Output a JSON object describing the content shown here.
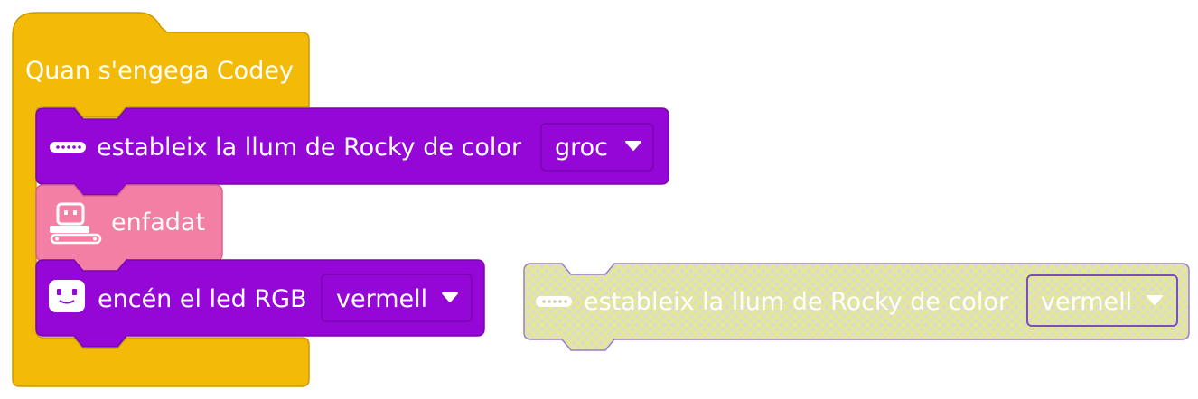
{
  "colors": {
    "hat": "#f3bb07",
    "hat_stroke": "#c99a05",
    "purple": "#9407d6",
    "purple_stroke": "#7a05b0",
    "pink": "#f47fa4",
    "pink_stroke": "#d6648a",
    "disabled_fill": "#dcdbd0",
    "disabled_hatch": "#e6ea8a",
    "disabled_stroke": "#9a7fc4"
  },
  "hat_block": {
    "label": "Quan s'engega Codey"
  },
  "block_rocky_light": {
    "icon": "rocky-light-icon",
    "label": "estableix la llum de Rocky de color",
    "dropdown_value": "groc"
  },
  "block_emotion": {
    "icon": "codey-rocky-icon",
    "label": "enfadat"
  },
  "block_rgb_led": {
    "icon": "codey-face-icon",
    "label": "encén el led RGB",
    "dropdown_value": "vermell"
  },
  "block_disabled_rocky_light": {
    "icon": "rocky-light-icon",
    "label": "estableix la llum de Rocky de color",
    "dropdown_value": "vermell",
    "disabled": true
  }
}
